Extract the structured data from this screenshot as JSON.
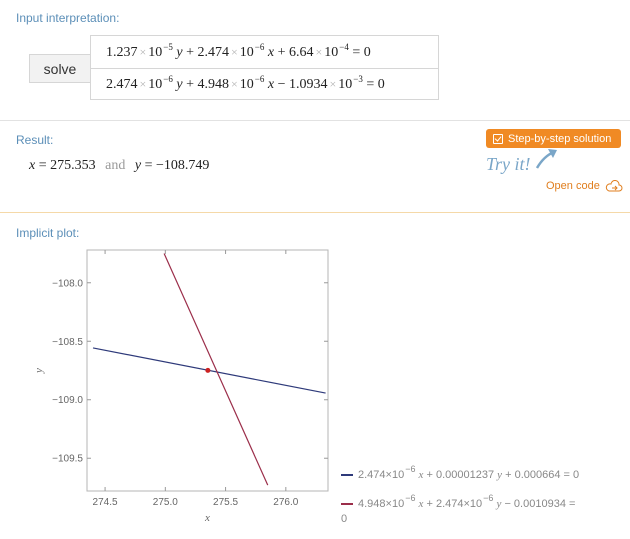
{
  "input": {
    "label": "Input interpretation:",
    "command": "solve",
    "eq1": {
      "a": "1.237",
      "a_exp": "−5",
      "b": "2.474",
      "b_exp": "−6",
      "c": "6.64",
      "c_exp": "−4",
      "rhs": "0"
    },
    "eq2": {
      "a": "2.474",
      "a_exp": "−6",
      "b": "4.948",
      "b_exp": "−6",
      "c": "1.0934",
      "c_exp": "−3",
      "rhs": "0"
    }
  },
  "result": {
    "label": "Result:",
    "x_val": "275.353",
    "and_text": "and",
    "y_val": "−108.749",
    "step_button": "Step-by-step solution",
    "try_it": "Try it!",
    "open_code": "Open code"
  },
  "plot": {
    "label": "Implicit plot:",
    "legend1": {
      "pre": "2.474",
      "mid": "x",
      "rest": "+ 0.00001237",
      "y": "y",
      "tail": "+ 0.000664 = 0"
    },
    "legend2": {
      "pre": "4.948",
      "mid": "x",
      "rest": "+ 2.474",
      "y": "y",
      "tail": "− 0.0010934 =",
      "end": "0"
    },
    "times": "×10",
    "exp": "−6",
    "line1_color": "#2e3a7a",
    "line2_color": "#9b2e4a",
    "point_color": "#cc2222"
  },
  "chart_data": {
    "type": "line",
    "xlabel": "x",
    "ylabel": "y",
    "xlim": [
      274.35,
      276.35
    ],
    "ylim": [
      -109.78,
      -107.72
    ],
    "xticks": [
      "274.5",
      "275.0",
      "275.5",
      "276.0"
    ],
    "xtick_values": [
      274.5,
      275.0,
      275.5,
      276.0
    ],
    "yticks": [
      "−108.0",
      "−108.5",
      "−109.0",
      "−109.5"
    ],
    "ytick_values": [
      -108.0,
      -108.5,
      -109.0,
      -109.5
    ],
    "grid": false,
    "series": [
      {
        "values_x": [
          274.4,
          276.33
        ],
        "values_y": [
          -108.557,
          -108.943
        ]
      },
      {
        "values_x": [
          274.99,
          275.85
        ],
        "values_y": [
          -107.75,
          -109.73
        ]
      }
    ],
    "intersection": {
      "x": 275.353,
      "y": -108.749
    }
  }
}
